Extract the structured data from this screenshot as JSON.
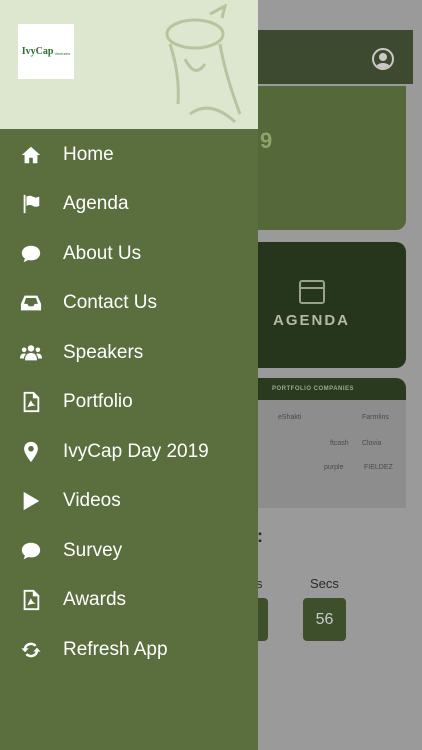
{
  "colors": {
    "drawer_bg": "#5a6e3e",
    "drawer_header_bg": "#dde6cf",
    "menu_text": "#ffffff",
    "app_dim": "#9a9a9a"
  },
  "drawer": {
    "logo_text": "IvyCap",
    "logo_sub": "Ventures",
    "menu": [
      {
        "label": "Home",
        "icon": "home-icon"
      },
      {
        "label": "Agenda",
        "icon": "flag-icon"
      },
      {
        "label": "About Us",
        "icon": "chat-bubble-icon"
      },
      {
        "label": "Contact Us",
        "icon": "inbox-tray-icon"
      },
      {
        "label": "Speakers",
        "icon": "users-group-icon"
      },
      {
        "label": "Portfolio",
        "icon": "pdf-file-icon"
      },
      {
        "label": "IvyCap Day 2019",
        "icon": "map-pin-icon"
      },
      {
        "label": "Videos",
        "icon": "play-icon"
      },
      {
        "label": "Survey",
        "icon": "chat-bubble-icon"
      },
      {
        "label": "Awards",
        "icon": "pdf-file-icon"
      },
      {
        "label": "Refresh App",
        "icon": "refresh-icon"
      }
    ]
  },
  "background_app": {
    "hero_fragment": "9",
    "agenda_label": "AGENDA",
    "portfolio_title": "PORTFOLIO COMPANIES",
    "portfolio_logos": [
      "eShakti",
      "Farmlins",
      "ftcash",
      "Clovia",
      "purple",
      "FIELDEZ"
    ],
    "countdown_colon": ":",
    "mins_label_fragment": "s",
    "secs_label": "Secs",
    "secs_value": "56"
  }
}
